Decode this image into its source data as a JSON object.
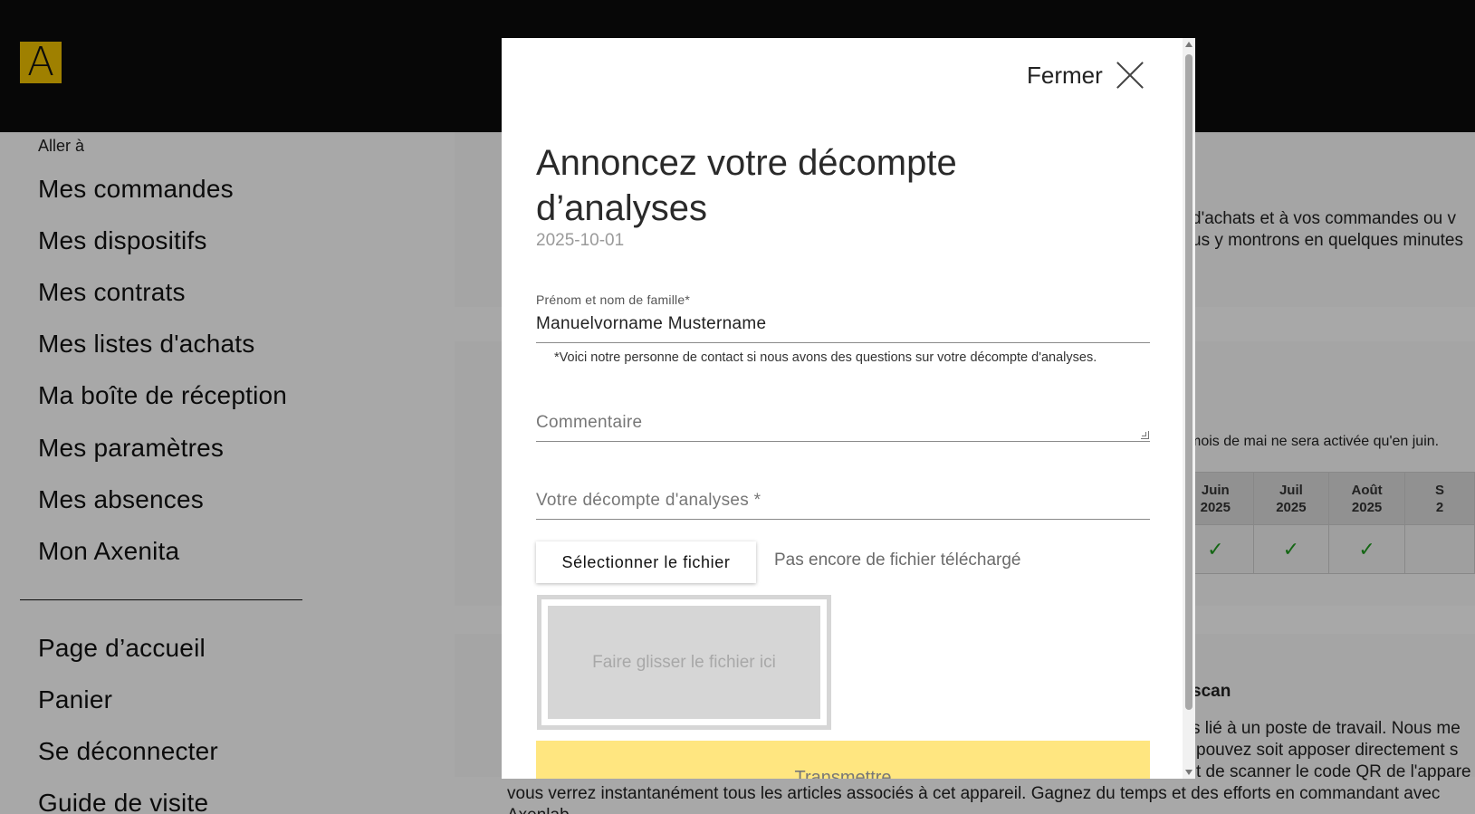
{
  "header": {
    "logo_letter": "A",
    "brand_color": "#f2c200"
  },
  "sidebar": {
    "goto_label": "Aller à",
    "items": [
      {
        "label": "Mes commandes"
      },
      {
        "label": "Mes dispositifs"
      },
      {
        "label": "Mes contrats"
      },
      {
        "label": "Mes listes d'achats"
      },
      {
        "label": "Ma boîte de réception"
      },
      {
        "label": "Mes paramètres"
      },
      {
        "label": "Mes absences"
      },
      {
        "label": "Mon Axenita"
      }
    ],
    "secondary_items": [
      {
        "label": "Page d’accueil"
      },
      {
        "label": "Panier"
      },
      {
        "label": "Se déconnecter"
      },
      {
        "label": "Guide de visite"
      }
    ]
  },
  "background": {
    "intro_line1": "d'achats et à vos commandes ou v",
    "intro_line2": "us y montrons en quelques minutes",
    "activation_note": "mois de mai ne sera activée qu'en juin.",
    "months": [
      {
        "month": "Juin",
        "year": "2025",
        "checked": true
      },
      {
        "month": "Juil",
        "year": "2025",
        "checked": true
      },
      {
        "month": "Août",
        "year": "2025",
        "checked": true
      },
      {
        "month": "S",
        "year": "2",
        "checked": false
      }
    ],
    "scan_heading": "scan",
    "scan_line1": "s lié à un poste de travail. Nous me",
    "scan_line2": "pouvez soit apposer directement s",
    "scan_line3": "t de scanner le code QR de l'appare",
    "scan_line4": "vous verrez instantanément tous les articles associés à cet appareil. Gagnez du temps et des efforts en commandant avec",
    "scan_line5": "Axenlab"
  },
  "modal": {
    "close_label": "Fermer",
    "title": "Annoncez votre décompte d’analyses",
    "date": "2025-10-01",
    "name_field": {
      "label": "Prénom et nom de famille*",
      "value": "Manuelvorname Mustername"
    },
    "hint": "*Voici notre personne de contact si nous avons des questions sur votre décompte d'analyses.",
    "comment_placeholder": "Commentaire",
    "analysis_field_label": "Votre décompte d'analyses *",
    "file_button": "Sélectionner le fichier",
    "file_status": "Pas encore de fichier téléchargé",
    "dropzone_label": "Faire glisser le fichier ici",
    "submit_label": "Transmettre"
  },
  "colors": {
    "submit_bg": "#ffe680",
    "check": "#1f9c1f",
    "overlay": "rgba(0,0,0,0.34)"
  }
}
